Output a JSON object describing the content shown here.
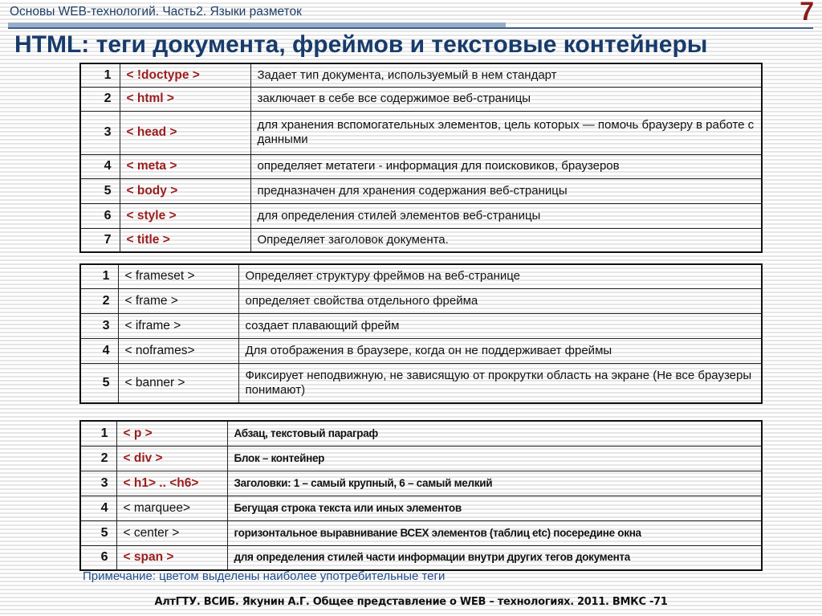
{
  "header": {
    "subtitle": "Основы WEB-технологий. Часть2. Языки разметок",
    "slide_number": "7",
    "title": "HTML: теги документа, фреймов и текстовые контейнеры"
  },
  "colors": {
    "highlight_tag": "#9b1c1c",
    "title": "#173b6b",
    "note": "#1f4e8c",
    "slide_number": "#8b1a1a"
  },
  "document_tags": [
    {
      "num": "1",
      "tag": "< !doctype >",
      "desc": "Задает тип документа, используемый в нем стандарт",
      "highlighted": true
    },
    {
      "num": "2",
      "tag": "< html >",
      "desc": "заключает в себе все содержимое веб-страницы",
      "highlighted": true
    },
    {
      "num": "3",
      "tag": "< head >",
      "desc": "для хранения вспомогательных элементов, цель которых — помочь браузеру в работе с данными",
      "highlighted": true
    },
    {
      "num": "4",
      "tag": "< meta >",
      "desc": "определяет метатеги - информация для поисковиков, браузеров",
      "highlighted": true
    },
    {
      "num": "5",
      "tag": "< body >",
      "desc": "предназначен для хранения содержания веб-страницы",
      "highlighted": true
    },
    {
      "num": "6",
      "tag": "< style >",
      "desc": "для определения стилей элементов веб-страницы",
      "highlighted": true
    },
    {
      "num": "7",
      "tag": "< title >",
      "desc": "Определяет заголовок документа.",
      "highlighted": true
    }
  ],
  "frame_tags": [
    {
      "num": "1",
      "tag": "< frameset >",
      "desc": "Определяет структуру фреймов на веб-странице",
      "highlighted": false
    },
    {
      "num": "2",
      "tag": "< frame >",
      "desc": "определяет свойства отдельного фрейма",
      "highlighted": false
    },
    {
      "num": "3",
      "tag": "< iframe >",
      "desc": "создает плавающий фрейм",
      "highlighted": false
    },
    {
      "num": "4",
      "tag": "< noframes>",
      "desc": "Для отображения  в браузере, когда он не поддерживает фреймы",
      "highlighted": false
    },
    {
      "num": "5",
      "tag": "< banner >",
      "desc": "Фиксирует неподвижную, не зависящую от прокрутки область на экране (Не все браузеры понимают)",
      "highlighted": false
    }
  ],
  "text_container_tags": [
    {
      "num": "1",
      "tag": "< p >",
      "desc": "Абзац, текстовый параграф",
      "highlighted": true
    },
    {
      "num": "2",
      "tag": "< div >",
      "desc": "Блок – контейнер",
      "highlighted": true
    },
    {
      "num": "3",
      "tag": "< h1>  .. <h6>",
      "desc": "Заголовки: 1 – самый крупный, 6 – самый мелкий",
      "highlighted": true
    },
    {
      "num": "4",
      "tag": "< marquee>",
      "desc": "Бегущая строка текста или иных элементов",
      "highlighted": false
    },
    {
      "num": "5",
      "tag": "< center >",
      "desc": "горизонтальное выравнивание ВСЕХ элементов (таблиц etc) посередине окна",
      "highlighted": false
    },
    {
      "num": "6",
      "tag": "< span >",
      "desc": "для определения стилей части информации внутри других тегов документа",
      "highlighted": true
    }
  ],
  "note": "Примечание: цветом выделены наиболее употребительные теги",
  "footer": "АлтГТУ. ВСИБ. Якунин А.Г.  Общее представление о WEB – технологиях. 2011. ВМКС -71"
}
